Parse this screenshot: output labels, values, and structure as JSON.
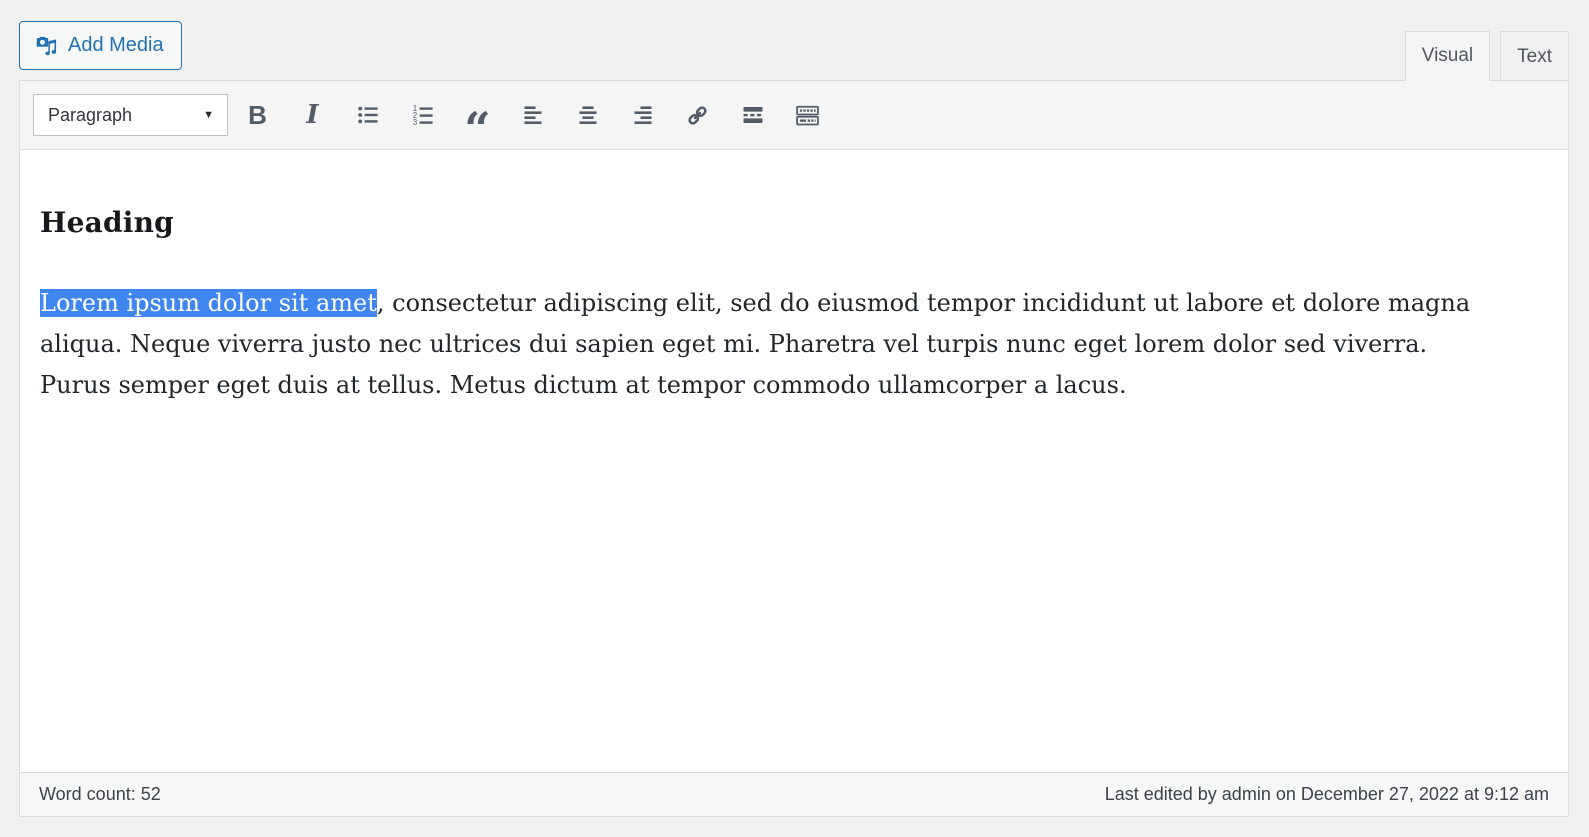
{
  "media_buttons": {
    "add_media_label": "Add Media"
  },
  "tabs": {
    "visual": "Visual",
    "text": "Text"
  },
  "toolbar": {
    "format_value": "Paragraph",
    "caret_glyph": "▼",
    "bold_glyph": "B",
    "italic_glyph": "I",
    "blockquote_glyph": "“",
    "ol_digits": {
      "d1": "1",
      "d2": "2",
      "d3": "3"
    },
    "button_names": [
      "bold",
      "italic",
      "bulleted-list",
      "numbered-list",
      "blockquote",
      "align-left",
      "align-center",
      "align-right",
      "insert-link",
      "insert-read-more",
      "toolbar-toggle"
    ]
  },
  "content": {
    "heading": "Heading",
    "selected_text": "Lorem ipsum dolor sit amet",
    "paragraph_rest": ", consectetur adipiscing elit, sed do eiusmod tempor incididunt ut labore et dolore magna aliqua. Neque viverra justo nec ultrices dui sapien eget mi. Pharetra vel turpis nunc eget lorem dolor sed viverra. Purus semper eget duis at tellus. Metus dictum at tempor commodo ullamcorper a lacus."
  },
  "statusbar": {
    "word_count": "Word count: 52",
    "last_edited": "Last edited by admin on December 27, 2022 at 9:12 am"
  },
  "colors": {
    "accent_blue": "#2271b1",
    "selection_blue": "#3f86f0",
    "icon_gray": "#535c66",
    "page_background": "#f0f0f1",
    "toolbar_background": "#f5f5f6",
    "border_gray": "#dcdcde"
  }
}
